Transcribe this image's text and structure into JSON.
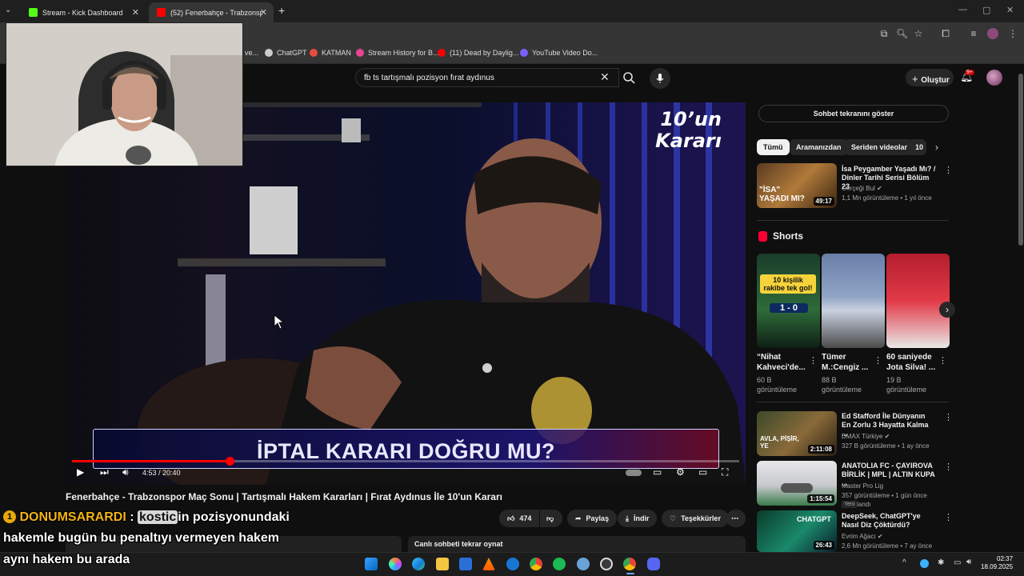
{
  "browser": {
    "tabs": [
      {
        "label": "Stream - Kick Dashboard",
        "color": "#53fc18"
      },
      {
        "label": "(52) Fenerbahçe - Trabzonspor",
        "color": "#ff0000"
      }
    ],
    "new_tab": "+",
    "bookmarks": [
      {
        "label": "ve...",
        "color": "#888888"
      },
      {
        "label": "ChatGPT",
        "color": "#cccccc"
      },
      {
        "label": "KATMAN",
        "color": "#e74c3c"
      },
      {
        "label": "Stream History for B...",
        "color": "#e84393"
      },
      {
        "label": "(11) Dead by Daylig...",
        "color": "#ff0000"
      },
      {
        "label": "YouTube Video Do...",
        "color": "#7b61ff"
      }
    ]
  },
  "youtube": {
    "search_value": "fb ts tartışmalı pozisyon fırat aydınus",
    "create_label": "Oluştur",
    "notif_count": "9+",
    "video": {
      "logo_line1": "10’un",
      "logo_line2": "Kararı",
      "lower_third": "İPTAL KARARI DOĞRU MU?",
      "time": "4:53 / 20:40",
      "progress": 0.2366,
      "title": "Fenerbahçe - Trabzonspor Maç Sonu | Tartışmalı Hakem Kararları | Fırat Aydınus İle 10'un Kararı"
    },
    "actions": {
      "likes": "474",
      "share": "Paylaş",
      "download": "İndir",
      "thanks": "Teşekkürler",
      "more": "⋯"
    },
    "chat_replay": "Canlı sohbeti tekrar oynat",
    "chat_show": "Sohbet tekranını göster",
    "chips": [
      "Tümü",
      "Aramanızdan",
      "Seriden videolar",
      "10"
    ],
    "related": [
      {
        "title": "İsa Peygamber Yaşadı Mı? / Dinler Tarihi Serisi Bölüm 23",
        "channel": "Gerçeği Bul ✔",
        "meta": "1,1 Mn görüntüleme • 1 yıl önce",
        "duration": "49:17",
        "thumb_text": "\"İSA\" YAŞADI MI?"
      },
      {
        "title": "Ed Stafford İle Dünyanın En Zorlu 3 Hayatta Kalma ...",
        "channel": "DMAX Türkiye ✔",
        "meta": "327 B görüntüleme • 1 ay önce",
        "duration": "2:11:08",
        "thumb_text": "AVLA, PİŞİR, YE"
      },
      {
        "title": "ANATOLIA FC - ÇAYIROVA BİRLİK | MPL | ALTIN KUPA ...",
        "channel": "Master Pro Lig",
        "meta": "357 görüntüleme • 1 gün önce yayınlandı",
        "duration": "1:15:54",
        "badge": "Yeni"
      },
      {
        "title": "DeepSeek, ChatGPT'ye Nasıl Diz Çöktürdü?",
        "channel": "Evrim Ağacı ✔",
        "meta": "2,6 Mn görüntüleme • 7 ay önce",
        "duration": "26:43",
        "thumb_text": "CHATGPT"
      }
    ],
    "shorts_label": "Shorts",
    "shorts": [
      {
        "title": "“Nihat Kahveci'de...",
        "views": "60 B görüntüleme",
        "thumb_text": "10 kişilik rakibe tek gol!",
        "score": "1 - 0"
      },
      {
        "title": "Tümer M.:Cengiz ...",
        "views": "88 B görüntüleme"
      },
      {
        "title": "60 saniyede Jota Silva! ...",
        "views": "19 B görüntüleme"
      }
    ]
  },
  "overlay_chat": {
    "rank": "1",
    "username": "DONUMSARARDI",
    "separator": ":",
    "mention": "kostic",
    "line1_rest": "in pozisyonundaki",
    "line2": "hakemle bugün bu penaltıyı vermeyen hakem",
    "line3": "aynı hakem bu arada"
  },
  "taskbar": {
    "time": "02:37",
    "date": "18.09.2025"
  }
}
